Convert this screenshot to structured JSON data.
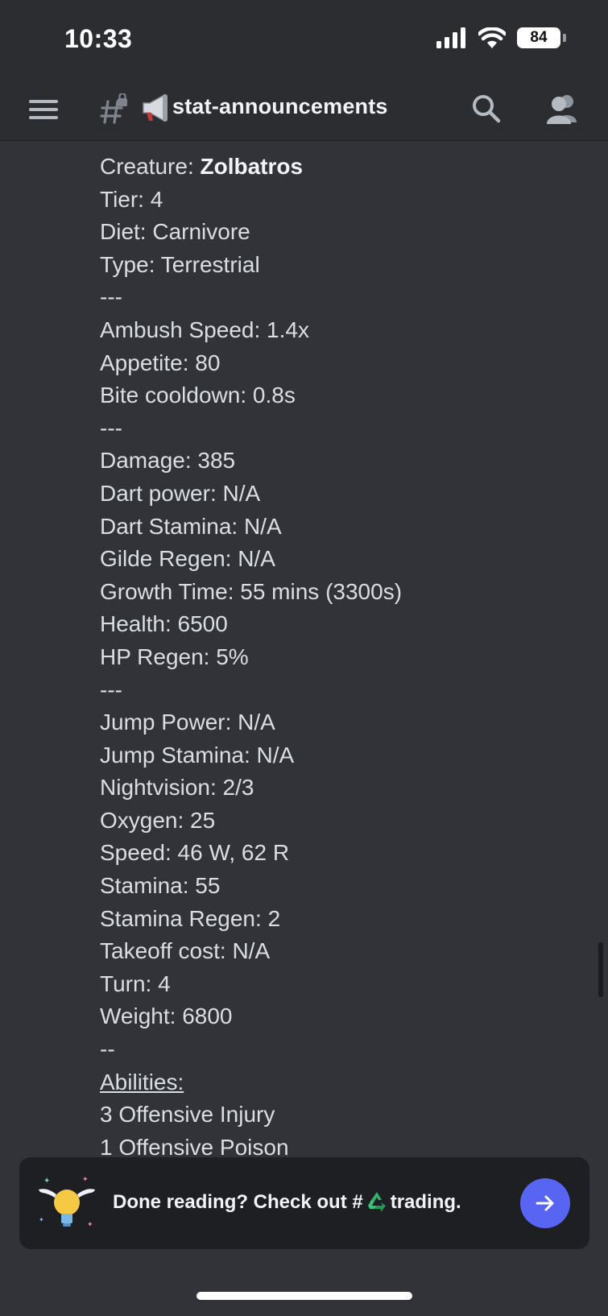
{
  "status_bar": {
    "time": "10:33",
    "battery": "84"
  },
  "header": {
    "channel_name": "stat-announcements"
  },
  "message": {
    "creature_label": "Creature: ",
    "creature_name": "Zolbatros",
    "lines": [
      "Tier: 4",
      "Diet: Carnivore",
      "Type: Terrestrial",
      "---",
      "Ambush Speed: 1.4x",
      "Appetite: 80",
      "Bite cooldown: 0.8s",
      "---",
      "Damage: 385",
      "Dart power: N/A",
      "Dart Stamina: N/A",
      "Gilde Regen: N/A",
      "Growth Time: 55 mins (3300s)",
      "Health: 6500",
      "HP Regen: 5%",
      "---",
      "Jump Power: N/A",
      "Jump Stamina: N/A",
      "Nightvision: 2/3",
      "Oxygen: 25",
      "Speed: 46 W, 62 R",
      "Stamina: 55",
      "Stamina Regen: 2",
      "Takeoff cost: N/A",
      "Turn: 4",
      "Weight: 6800",
      "--"
    ],
    "abilities_heading": "Abilities:",
    "abilities": [
      "3 Offensive Injury",
      "1 Offensive Poison"
    ]
  },
  "cta": {
    "text_before": "Done reading? Check out #",
    "text_after": "trading.",
    "icons": [
      "bulb-with-wings-icon",
      "recycle-icon",
      "arrow-right-icon"
    ]
  },
  "colors": {
    "background": "#313338",
    "header": "#2b2d31",
    "cta_background": "#1e1f22",
    "accent": "#5865f2"
  }
}
